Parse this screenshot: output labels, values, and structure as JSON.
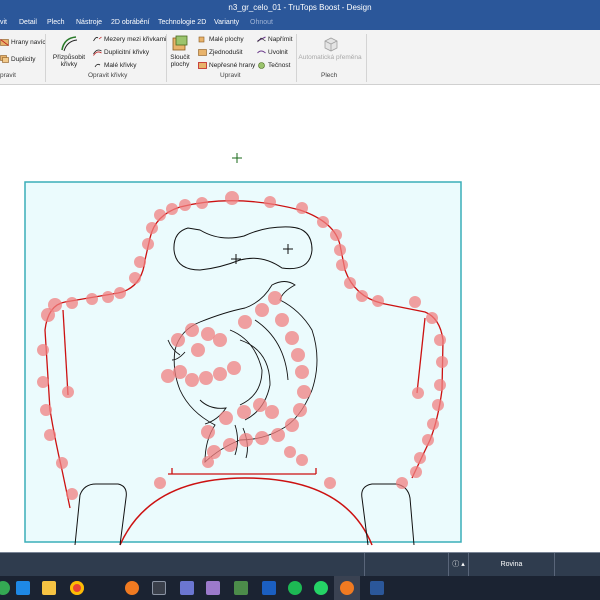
{
  "window": {
    "title": "n3_gr_celo_01 - TruTops Boost - Design"
  },
  "menu": [
    {
      "label": "vit",
      "enabled": true
    },
    {
      "label": "Detail",
      "enabled": true
    },
    {
      "label": "Plech",
      "enabled": true
    },
    {
      "label": "Nástroje",
      "enabled": true
    },
    {
      "label": "2D obrábění",
      "enabled": true
    },
    {
      "label": "Technologie 2D",
      "enabled": true
    },
    {
      "label": "Varianty",
      "enabled": true
    },
    {
      "label": "Ohnout",
      "enabled": false
    }
  ],
  "ribbon": {
    "group_upravit_left": {
      "label": "pravit",
      "items": [
        "Hrany navíc",
        "Duplicity"
      ]
    },
    "group_opravit_krivky": {
      "label": "Opravit křivky",
      "big_button": "Přizpůsobit křivky",
      "items": [
        "Mezery mezi křivkami",
        "Duplicitní křivky",
        "Malé křivky"
      ]
    },
    "group_upravit": {
      "label": "Upravit",
      "big_button": "Sloučit plochy",
      "items_col1": [
        "Malé plochy",
        "Zjednodušit",
        "Nepřesné hrany"
      ],
      "items_col2": [
        "Napřímit",
        "Uvolnit",
        "Tečnost"
      ]
    },
    "group_plech": {
      "label": "Plech",
      "big_button": "Automatická přeměna"
    }
  },
  "statusbar": {
    "info_icon": "info-icon",
    "mode": "Rovina"
  },
  "taskbar": {
    "apps": [
      "windows-icon",
      "mail-icon",
      "file-explorer-icon",
      "chrome-icon",
      "app-orange-icon",
      "calculator-icon",
      "trutops-icon",
      "save-icon",
      "edit-icon",
      "chart-icon",
      "store-icon",
      "tool-icon",
      "spotify-icon",
      "whatsapp-icon",
      "trutops-active-icon",
      "word-icon"
    ]
  },
  "colors": {
    "titlebar": "#2b579a",
    "part_fill": "#ebfbfd",
    "part_border": "#3aaeb8",
    "contour": "#cc1111",
    "error_marker": "#f08080"
  }
}
